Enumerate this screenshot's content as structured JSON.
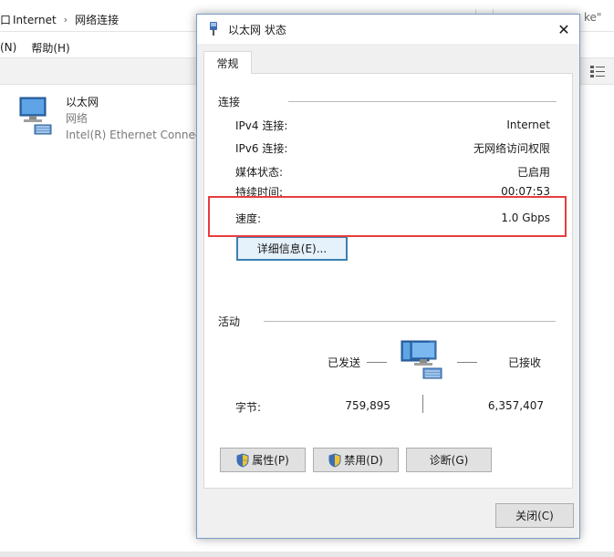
{
  "background": {
    "breadcrumb": [
      "Internet",
      "网络连接"
    ],
    "breadcrumb_prefix": "口",
    "search_tail": "ke\"",
    "menu": [
      "(N)",
      "帮助(H)"
    ],
    "adapter": {
      "name": "以太网",
      "status": "网络",
      "device": "Intel(R) Ethernet Connect"
    }
  },
  "dialog": {
    "title": "以太网 状态",
    "close_glyph": "✕",
    "tab": "常规",
    "connection": {
      "heading": "连接",
      "rows": [
        {
          "label": "IPv4 连接:",
          "value": "Internet"
        },
        {
          "label": "IPv6 连接:",
          "value": "无网络访问权限"
        },
        {
          "label": "媒体状态:",
          "value": "已启用"
        },
        {
          "label": "持续时间:",
          "value": "00:07:53"
        },
        {
          "label": "速度:",
          "value": "1.0 Gbps"
        }
      ],
      "details_button": "详细信息(E)..."
    },
    "activity": {
      "heading": "活动",
      "sent_label": "已发送",
      "received_label": "已接收",
      "bytes_label": "字节:",
      "bytes_sent": "759,895",
      "bytes_received": "6,357,407"
    },
    "buttons": {
      "properties": "属性(P)",
      "disable": "禁用(D)",
      "diagnose": "诊断(G)",
      "close": "关闭(C)"
    }
  },
  "colors": {
    "highlight_border": "#e83d3d",
    "focus_border": "#3c7fb1",
    "dialog_bg": "#f0f0f0"
  },
  "icons": [
    "network-adapter-icon",
    "ethernet-port-icon",
    "shield-icon",
    "close-icon",
    "view-mode-icon"
  ]
}
